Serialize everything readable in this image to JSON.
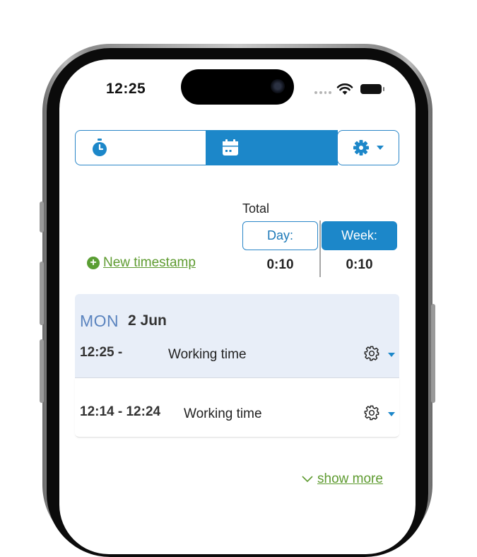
{
  "status_bar": {
    "time": "12:25"
  },
  "toolbar": {
    "timer_icon": "stopwatch-icon",
    "calendar_icon": "calendar-icon",
    "settings_icon": "gear-icon",
    "accent": "#1c87c9"
  },
  "totals": {
    "label": "Total",
    "day_label": "Day:",
    "week_label": "Week:",
    "day_value": "0:10",
    "week_value": "0:10"
  },
  "actions": {
    "new_timestamp": "New timestamp",
    "show_more": "show more"
  },
  "day": {
    "weekday": "MON",
    "date": "2 Jun"
  },
  "entries": [
    {
      "time": "12:25 -",
      "type": "Working time"
    },
    {
      "time": "12:14 - 12:24",
      "type": "Working time"
    }
  ]
}
